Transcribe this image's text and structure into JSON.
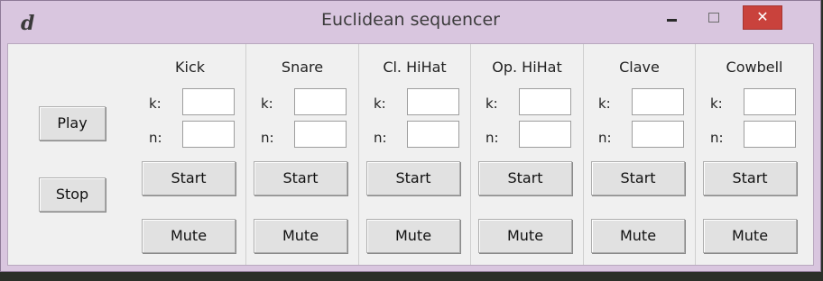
{
  "window": {
    "title": "Euclidean sequencer",
    "app_icon_glyph": "d",
    "close_glyph": "✕"
  },
  "transport": {
    "play_label": "Play",
    "stop_label": "Stop"
  },
  "field_labels": {
    "k": "k:",
    "n": "n:"
  },
  "channels": [
    {
      "name": "Kick",
      "k": "",
      "n": "",
      "start_label": "Start",
      "mute_label": "Mute"
    },
    {
      "name": "Snare",
      "k": "",
      "n": "",
      "start_label": "Start",
      "mute_label": "Mute"
    },
    {
      "name": "Cl. HiHat",
      "k": "",
      "n": "",
      "start_label": "Start",
      "mute_label": "Mute"
    },
    {
      "name": "Op. HiHat",
      "k": "",
      "n": "",
      "start_label": "Start",
      "mute_label": "Mute"
    },
    {
      "name": "Clave",
      "k": "",
      "n": "",
      "start_label": "Start",
      "mute_label": "Mute"
    },
    {
      "name": "Cowbell",
      "k": "",
      "n": "",
      "start_label": "Start",
      "mute_label": "Mute"
    }
  ],
  "colors": {
    "title_bar": "#d9c6df",
    "close_button": "#c9423c",
    "client_background": "#f0f0f0"
  }
}
